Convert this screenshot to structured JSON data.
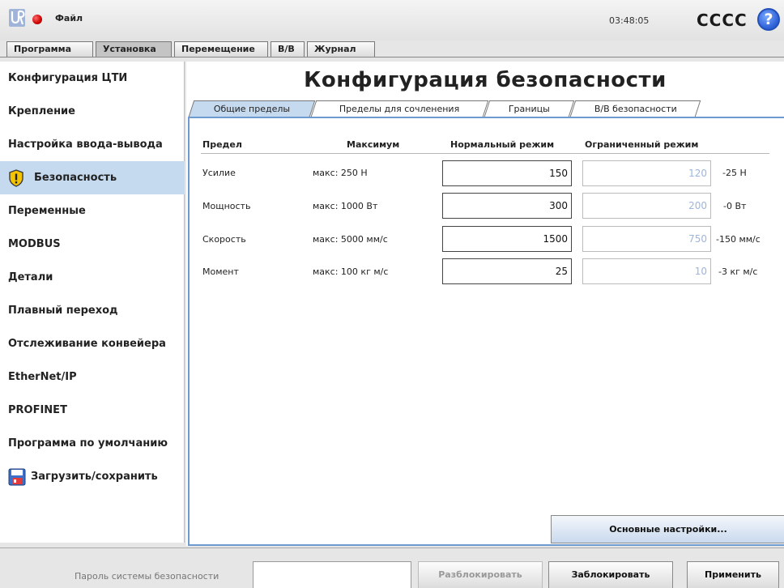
{
  "header": {
    "file_menu": "Файл",
    "clock": "03:48:05",
    "robot_name": "CCCC",
    "help": "?"
  },
  "main_tabs": [
    {
      "label": "Программа"
    },
    {
      "label": "Установка"
    },
    {
      "label": "Перемещение"
    },
    {
      "label": "В/В"
    },
    {
      "label": "Журнал"
    }
  ],
  "sidebar": {
    "items": [
      {
        "label": "Конфигурация ЦТИ"
      },
      {
        "label": "Крепление"
      },
      {
        "label": "Настройка ввода-вывода"
      },
      {
        "label": "Безопасность"
      },
      {
        "label": "Переменные"
      },
      {
        "label": "MODBUS"
      },
      {
        "label": "Детали"
      },
      {
        "label": "Плавный переход"
      },
      {
        "label": "Отслеживание конвейера"
      },
      {
        "label": "EtherNet/IP"
      },
      {
        "label": "PROFINET"
      },
      {
        "label": "Программа по умолчанию"
      },
      {
        "label": "Загрузить/сохранить"
      }
    ]
  },
  "main": {
    "title": "Конфигурация безопасности",
    "sub_tabs": [
      {
        "label": "Общие пределы"
      },
      {
        "label": "Пределы для сочленения"
      },
      {
        "label": "Границы"
      },
      {
        "label": "В/В безопасности"
      }
    ],
    "columns": {
      "limit": "Предел",
      "max": "Максимум",
      "normal": "Нормальный режим",
      "reduced": "Ограниченный режим"
    },
    "rows": [
      {
        "label": "Усилие",
        "max": "макс: 250 Н",
        "normal": "150",
        "reduced": "120",
        "diff": "-25 Н"
      },
      {
        "label": "Мощность",
        "max": "макс: 1000 Вт",
        "normal": "300",
        "reduced": "200",
        "diff": "-0 Вт"
      },
      {
        "label": "Скорость",
        "max": "макс: 5000 мм/с",
        "normal": "1500",
        "reduced": "750",
        "diff": "-150 мм/с"
      },
      {
        "label": "Момент",
        "max": "макс: 100 кг м/с",
        "normal": "25",
        "reduced": "10",
        "diff": "-3 кг м/с"
      }
    ],
    "basic_settings_button": "Основные настройки..."
  },
  "footer": {
    "password_label": "Пароль системы безопасности",
    "password_value": "",
    "unlock_button": "Разблокировать",
    "lock_button": "Заблокировать",
    "apply_button": "Применить"
  }
}
